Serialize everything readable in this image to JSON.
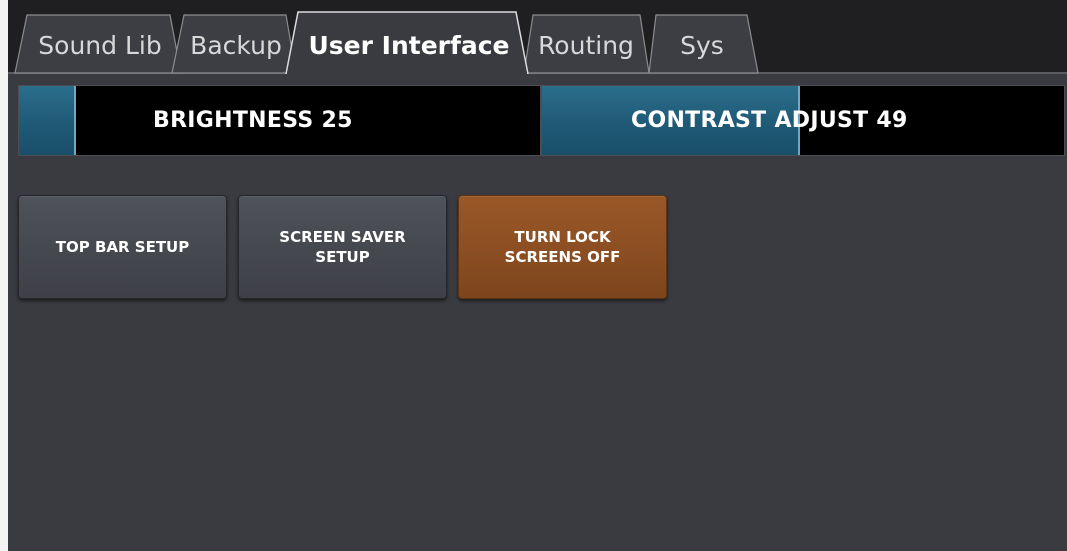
{
  "tabs": [
    {
      "label": "Sound Lib",
      "active": false
    },
    {
      "label": "Backup",
      "active": false
    },
    {
      "label": "User Interface",
      "active": true
    },
    {
      "label": "Routing",
      "active": false
    },
    {
      "label": "Sys",
      "active": false
    }
  ],
  "faders": {
    "brightness": {
      "label": "BRIGHTNESS 25",
      "level_percent": 25
    },
    "contrast": {
      "label": "CONTRAST ADJUST 49",
      "level_percent": 49
    }
  },
  "buttons": {
    "top_bar_setup": "TOP BAR SETUP",
    "screen_saver_setup": "SCREEN SAVER\nSETUP",
    "turn_lock_screens_off": "TURN LOCK\nSCREENS OFF"
  },
  "colors": {
    "background": "#3a3b40",
    "fader_fill": "#1f5a76",
    "accent_button": "#8a4d21"
  }
}
